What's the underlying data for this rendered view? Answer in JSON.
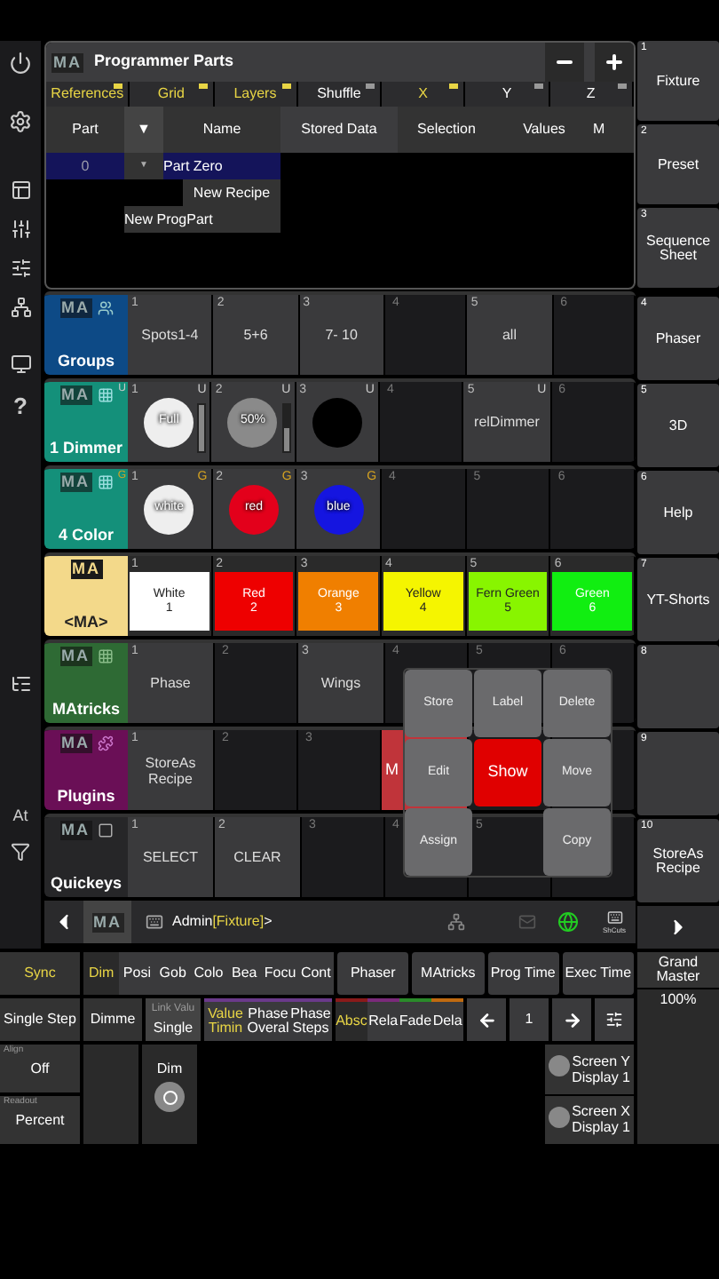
{
  "sidebar": {
    "help": "?",
    "at": "At"
  },
  "programmer": {
    "logo": "MA",
    "title": "Programmer Parts",
    "tabs": [
      {
        "label": "References",
        "on": true
      },
      {
        "label": "Grid",
        "on": true
      },
      {
        "label": "Layers",
        "on": true
      },
      {
        "label": "Shuffle",
        "on": false
      },
      {
        "label": "X",
        "on": true
      },
      {
        "label": "Y",
        "on": false
      },
      {
        "label": "Z",
        "on": false
      }
    ],
    "columns": [
      "Part",
      "▼",
      "Name",
      "Stored Data",
      "Selection",
      "Values",
      "M"
    ],
    "rows": [
      {
        "part": "0",
        "toggle": "▼",
        "name": "Part Zero",
        "selected": true
      }
    ],
    "recipe": "New Recipe",
    "new_part": "New ProgPart"
  },
  "pools": [
    {
      "kind": "groups",
      "logo": "MA",
      "title": "Groups",
      "color": "#0d4a86",
      "cells": [
        {
          "number": "1",
          "kind": "plain",
          "label": "Spots1-4"
        },
        {
          "number": "2",
          "kind": "plain",
          "label": "5+6"
        },
        {
          "number": "3",
          "kind": "plain",
          "label": "7- 10"
        },
        {
          "number": "4",
          "kind": "empty"
        },
        {
          "number": "5",
          "kind": "plain",
          "label": "all"
        },
        {
          "number": "6",
          "kind": "empty"
        }
      ]
    },
    {
      "kind": "dimmer",
      "logo": "MA",
      "title": "1 Dimmer",
      "flag": "U",
      "color": "#14907a",
      "cells": [
        {
          "number": "1",
          "kind": "swatch",
          "label": "Full",
          "color": "#eeeeee",
          "flag": "U",
          "level": 1
        },
        {
          "number": "2",
          "kind": "swatch",
          "label": "50%",
          "color": "#8a8a8a",
          "flag": "U",
          "level": 0.5
        },
        {
          "number": "3",
          "kind": "swatch",
          "color": "#000000",
          "flag": "U"
        },
        {
          "number": "4",
          "kind": "empty"
        },
        {
          "number": "5",
          "kind": "plain",
          "label": "relDimmer",
          "flag": "U"
        },
        {
          "number": "6",
          "kind": "empty"
        }
      ]
    },
    {
      "kind": "color",
      "logo": "MA",
      "title": "4 Color",
      "flag": "G",
      "color": "#14907a",
      "cells": [
        {
          "number": "1",
          "kind": "swatch",
          "label": "white",
          "color": "#eeeeee",
          "flag": "G"
        },
        {
          "number": "2",
          "kind": "swatch",
          "label": "red",
          "color": "#e3001b",
          "flag": "G"
        },
        {
          "number": "3",
          "kind": "swatch",
          "label": "blue",
          "color": "#1515e0",
          "flag": "G"
        },
        {
          "number": "4",
          "kind": "empty"
        },
        {
          "number": "5",
          "kind": "empty"
        },
        {
          "number": "6",
          "kind": "empty"
        }
      ]
    },
    {
      "kind": "appearances",
      "logo": "MA",
      "title": "<MA>",
      "color": "#f3d98a",
      "cells": [
        {
          "number": "1",
          "kind": "fill",
          "lines": [
            "White",
            "1"
          ],
          "color": "#ffffff"
        },
        {
          "number": "2",
          "kind": "fill",
          "lines": [
            "Red",
            "2"
          ],
          "color": "#ee0000"
        },
        {
          "number": "3",
          "kind": "fill",
          "lines": [
            "Orange",
            "3"
          ],
          "color": "#f07f00"
        },
        {
          "number": "4",
          "kind": "fill",
          "lines": [
            "Yellow",
            "4"
          ],
          "color": "#f5f500"
        },
        {
          "number": "5",
          "kind": "fill",
          "lines": [
            "Fern Green",
            "5"
          ],
          "color": "#88f500"
        },
        {
          "number": "6",
          "kind": "fill",
          "lines": [
            "Green",
            "6"
          ],
          "color": "#11ee11"
        }
      ]
    },
    {
      "kind": "matricks",
      "logo": "MA",
      "title": "MAtricks",
      "color": "#2e6a34",
      "cells": [
        {
          "number": "1",
          "kind": "plain",
          "label": "Phase"
        },
        {
          "number": "2",
          "kind": "empty"
        },
        {
          "number": "3",
          "kind": "plain",
          "label": "Wings"
        },
        {
          "number": "4",
          "kind": "empty"
        },
        {
          "number": "5",
          "kind": "empty"
        },
        {
          "number": "6",
          "kind": "empty"
        }
      ]
    },
    {
      "kind": "plugins",
      "logo": "MA",
      "title": "Plugins",
      "color": "#6a0f56",
      "cells": [
        {
          "number": "1",
          "kind": "plain",
          "label": "StoreAs Recipe"
        },
        {
          "number": "2",
          "kind": "empty"
        },
        {
          "number": "3",
          "kind": "empty"
        },
        {
          "kind": "red",
          "label": "M"
        },
        {
          "kind": "empty"
        },
        {
          "kind": "empty"
        }
      ]
    },
    {
      "kind": "quickeys",
      "logo": "MA",
      "title": "Quickeys",
      "color": "#262628",
      "cells": [
        {
          "number": "1",
          "kind": "plain",
          "label": "SELECT"
        },
        {
          "number": "2",
          "kind": "plain",
          "label": "CLEAR"
        },
        {
          "number": "3",
          "kind": "empty"
        },
        {
          "number": "4",
          "kind": "empty"
        },
        {
          "number": "5",
          "kind": "empty"
        },
        {
          "kind": "empty"
        }
      ]
    }
  ],
  "context_menu": [
    {
      "label": "Store",
      "selected": false
    },
    {
      "label": "Label",
      "selected": false
    },
    {
      "label": "Delete",
      "selected": false
    },
    {
      "label": "Edit",
      "selected": false
    },
    {
      "label": "Show",
      "selected": true
    },
    {
      "label": "Move",
      "selected": false
    },
    {
      "label": "Assign",
      "selected": false
    },
    {
      "label": "Copy",
      "selected": false
    }
  ],
  "views": [
    {
      "number": "1",
      "label": "Fixture"
    },
    {
      "number": "2",
      "label": "Preset"
    },
    {
      "number": "3",
      "label": "Sequence Sheet"
    },
    {
      "number": "4",
      "label": "Phaser"
    },
    {
      "number": "5",
      "label": "3D"
    },
    {
      "number": "6",
      "label": "Help"
    },
    {
      "number": "7",
      "label": "YT-Shorts"
    },
    {
      "number": "8"
    },
    {
      "number": "9"
    },
    {
      "number": "10",
      "label": "StoreAs Recipe"
    }
  ],
  "command_line": {
    "logo": "MA",
    "user": "Admin",
    "object": "[Fixture]",
    "prompt": ">",
    "shortcuts": "ShCuts"
  },
  "encoder_bar": {
    "sync": "Sync",
    "features": [
      {
        "label": "Dim",
        "selected": true
      },
      {
        "label": "Posi",
        "selected": false
      },
      {
        "label": "Gob",
        "selected": false
      },
      {
        "label": "Colo",
        "selected": false
      },
      {
        "label": "Bea",
        "selected": false
      },
      {
        "label": "Focu",
        "selected": false
      },
      {
        "label": "Cont",
        "selected": false
      }
    ],
    "tabs": [
      "Phaser",
      "MAtricks",
      "Prog Time",
      "Exec Time"
    ],
    "single_step": "Single Step",
    "attribute": "Dimme",
    "link_label": "Link Valu",
    "link_value": "Single",
    "layers": [
      {
        "lines": [
          "Value",
          "Timin"
        ],
        "selected": true
      },
      {
        "lines": [
          "Phase",
          "Overal"
        ],
        "selected": false
      },
      {
        "lines": [
          "Phase",
          "Steps"
        ],
        "selected": false
      }
    ],
    "modes": [
      {
        "label": "Absc",
        "selected": true,
        "color": "#8a1a1a"
      },
      {
        "label": "Rela",
        "selected": false,
        "color": "#7a2a7a"
      },
      {
        "label": "Fade",
        "selected": false,
        "color": "#2a8a2a"
      },
      {
        "label": "Dela",
        "selected": false,
        "color": "#c06a10"
      }
    ],
    "page": "1",
    "align": {
      "label": "Align",
      "value": "Off"
    },
    "readout": {
      "label": "Readout",
      "value": "Percent"
    },
    "encoder": "Dim",
    "screen": [
      {
        "axis": "Screen Y",
        "display": "Display 1"
      },
      {
        "axis": "Screen X",
        "display": "Display 1"
      }
    ]
  },
  "grand_master": {
    "label": "Grand Master",
    "value": "100%"
  }
}
